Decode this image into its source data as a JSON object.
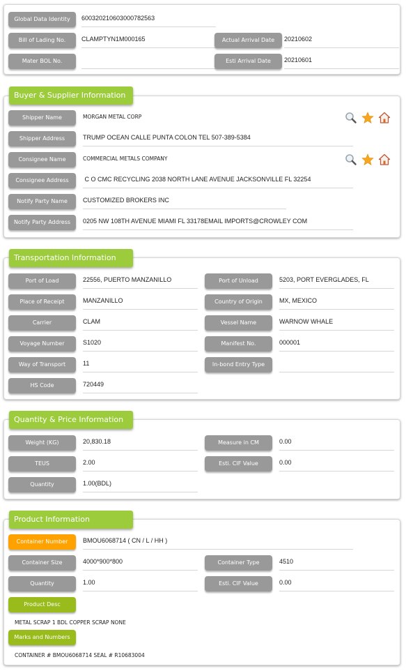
{
  "header": {
    "global_data_identity": {
      "label": "Global Data Identity",
      "value": "600320210603000782563"
    },
    "bill_of_lading": {
      "label": "Bill of Lading No.",
      "value": "CLAMPTYN1M000165"
    },
    "actual_arrival_date": {
      "label": "Actual Arrival Date",
      "value": "20210602"
    },
    "mater_bol": {
      "label": "Mater BOL No.",
      "value": ""
    },
    "esti_arrival_date": {
      "label": "Esti Arrival Date",
      "value": "20210601"
    }
  },
  "buyer_supplier": {
    "title": "Buyer & Supplier Information",
    "shipper_name": {
      "label": "Shipper Name",
      "value": "MORGAN METAL CORP"
    },
    "shipper_address": {
      "label": "Shipper Address",
      "value": "TRUMP OCEAN CALLE PUNTA COLON TEL 507-389-5384"
    },
    "consignee_name": {
      "label": "Consignee Name",
      "value": "COMMERCIAL METALS COMPANY"
    },
    "consignee_address": {
      "label": "Consignee Address",
      "value": " C O CMC RECYCLING 2038 NORTH LANE AVENUE JACKSONVILLE FL 32254"
    },
    "notify_party_name": {
      "label": "Notify Party Name",
      "value": "CUSTOMIZED BROKERS INC"
    },
    "notify_party_address": {
      "label": "Notify Party Address",
      "value": "0205 NW 108TH AVENUE MIAMI FL 33178EMAIL IMPORTS@CROWLEY COM"
    },
    "icons": [
      "search-icon",
      "star-icon",
      "home-icon"
    ]
  },
  "transportation": {
    "title": "Transportation Information",
    "port_of_load": {
      "label": "Port of Load",
      "value": "22556, PUERTO MANZANILLO"
    },
    "port_of_unload": {
      "label": "Port of Unload",
      "value": "5203, PORT EVERGLADES, FL"
    },
    "place_of_receipt": {
      "label": "Place of Receipt",
      "value": "MANZANILLO"
    },
    "country_of_origin": {
      "label": "Country of Origin",
      "value": "MX, MEXICO"
    },
    "carrier": {
      "label": "Carrier",
      "value": "CLAM"
    },
    "vessel_name": {
      "label": "Vessel Name",
      "value": "WARNOW WHALE"
    },
    "voyage_number": {
      "label": "Voyage Number",
      "value": "S1020"
    },
    "manifest_no": {
      "label": "Manifest No.",
      "value": "000001"
    },
    "way_of_transport": {
      "label": "Way of Transport",
      "value": "11"
    },
    "inbond_entry_type": {
      "label": "In-bond Entry Type",
      "value": ""
    },
    "hs_code": {
      "label": "HS Code",
      "value": "720449"
    }
  },
  "quantity_price": {
    "title": "Quantity & Price Information",
    "weight": {
      "label": "Weight (KG)",
      "value": "20,830.18"
    },
    "measure": {
      "label": "Measure in CM",
      "value": "0.00"
    },
    "teus": {
      "label": "TEUS",
      "value": "2.00"
    },
    "esti_cif": {
      "label": "Esti. CIF Value",
      "value": "0.00"
    },
    "quantity": {
      "label": "Quantity",
      "value": "1.00(BDL)"
    }
  },
  "product": {
    "title": "Product Information",
    "container_number": {
      "label": "Container Number",
      "value": "BMOU6068714 ( CN / L / HH )"
    },
    "container_size": {
      "label": "Container Size",
      "value": "4000*900*800"
    },
    "container_type": {
      "label": "Container Type",
      "value": "4510"
    },
    "quantity": {
      "label": "Quantity",
      "value": "1.00"
    },
    "esti_cif": {
      "label": "Esti. CIF Value",
      "value": "0.00"
    },
    "product_desc": {
      "label": "Product Desc",
      "value": "METAL SCRAP 1 BDL COPPER SCRAP NONE"
    },
    "marks_numbers": {
      "label": "Marks and Numbers",
      "value": "CONTAINER # BMOU6068714 SEAL # R10683004"
    }
  },
  "colors": {
    "section_header": "#9ccc3c",
    "label_gray": "#999999",
    "label_orange": "#ffa200",
    "label_green": "#99bb1c"
  }
}
